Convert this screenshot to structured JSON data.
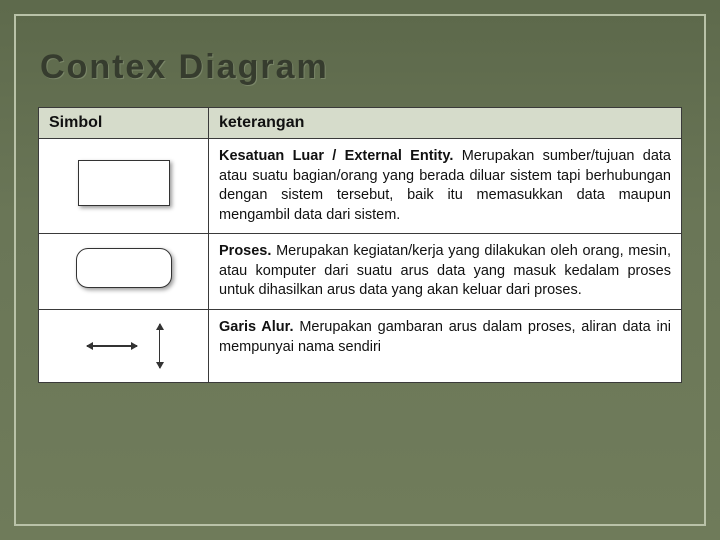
{
  "title": "Contex Diagram",
  "table": {
    "headers": {
      "col1": "Simbol",
      "col2": "keterangan"
    },
    "rows": [
      {
        "symbol": "external-entity-rect",
        "term": "Kesatuan Luar / External Entity.",
        "desc": " Merupakan sumber/tujuan data atau suatu bagian/orang yang berada diluar sistem tapi berhubungan dengan sistem tersebut, baik itu memasukkan data maupun mengambil data dari sistem."
      },
      {
        "symbol": "process-rounded",
        "term": "Proses.",
        "desc": " Merupakan kegiatan/kerja yang dilakukan oleh orang, mesin, atau komputer dari suatu arus data yang masuk kedalam proses untuk dihasilkan arus data yang akan keluar dari proses."
      },
      {
        "symbol": "flow-arrows",
        "term": "Garis Alur.",
        "desc": " Merupakan gambaran arus dalam proses, aliran data ini mempunyai nama sendiri"
      }
    ]
  }
}
